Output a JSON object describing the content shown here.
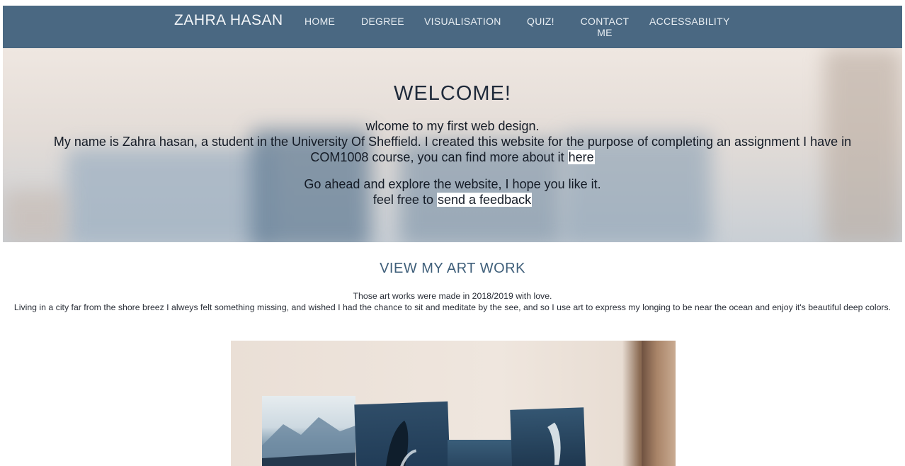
{
  "nav": {
    "brand": "ZAHRA HASAN",
    "items": [
      {
        "label": "HOME"
      },
      {
        "label": "DEGREE"
      },
      {
        "label": "VISUALISATION"
      },
      {
        "label": "QUIZ!"
      },
      {
        "label": "CONTACT ME"
      },
      {
        "label": "ACCESSABILITY"
      }
    ]
  },
  "hero": {
    "title": "WELCOME!",
    "line1": "wlcome to my first web design.",
    "line2": "My name is Zahra hasan, a student in the University Of Sheffield. I created this website for the purpose of completing an assignment I have in COM1008 course, you can find more about it",
    "link_here": "here",
    "line3": "Go ahead and explore the website, I hope you like it.",
    "line4": "feel free to",
    "link_feedback": "send a feedback"
  },
  "art": {
    "title": "VIEW MY ART WORK",
    "desc1": "Those art works were made in 2018/2019 with love.",
    "desc2": "Living in a city far from the shore breez I alweys felt something missing, and wished I had the chance to sit and meditate by the see, and so I use art to express my longing to be near the ocean and enjoy it's beautiful deep colors."
  },
  "colors": {
    "nav_bg": "#4a6882",
    "accent_title": "#3f5f7a"
  }
}
